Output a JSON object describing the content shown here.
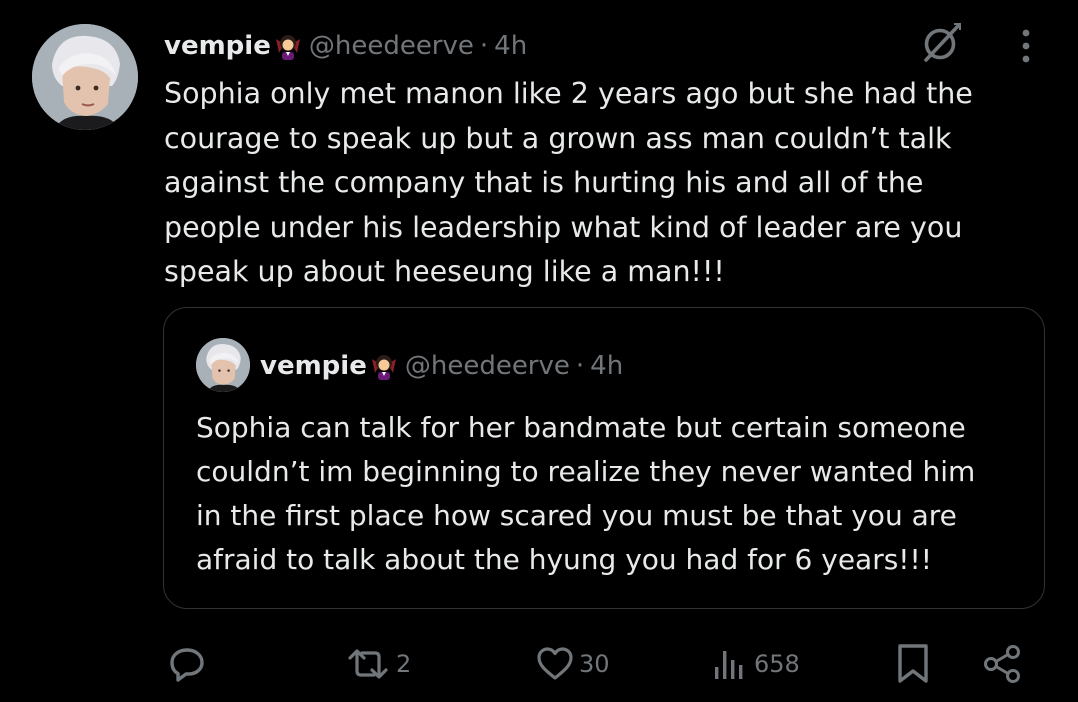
{
  "tweet": {
    "display_name": "vempie",
    "emoji_icon": "woman-vampire-emoji",
    "handle": "@heedeerve",
    "separator": "·",
    "time": "4h",
    "text": "Sophia only met manon like 2 years ago but she had the\ncourage to speak up but a grown ass man couldn’t talk\nagainst the company that is hurting his and all of the\npeople under his leadership what kind of leader are you\nspeak up about heeseung like a man!!!"
  },
  "quote": {
    "display_name": "vempie",
    "emoji_icon": "woman-vampire-emoji",
    "handle": "@heedeerve",
    "separator": "·",
    "time": "4h",
    "text": "Sophia can talk for her bandmate but certain someone\ncouldn’t im beginning to realize they never wanted him\nin the first place how scared you must be that you are\nafraid to talk about the hyung you had for 6 years!!!"
  },
  "actions": {
    "reply_icon": "reply-icon",
    "repost_icon": "repost-icon",
    "repost_count": "2",
    "like_icon": "heart-icon",
    "like_count": "30",
    "views_icon": "views-icon",
    "views_count": "658",
    "bookmark_icon": "bookmark-icon",
    "share_icon": "share-icon"
  },
  "colors": {
    "background": "#000000",
    "text": "#e7e9ea",
    "muted": "#71767b",
    "border": "#2f3336"
  }
}
